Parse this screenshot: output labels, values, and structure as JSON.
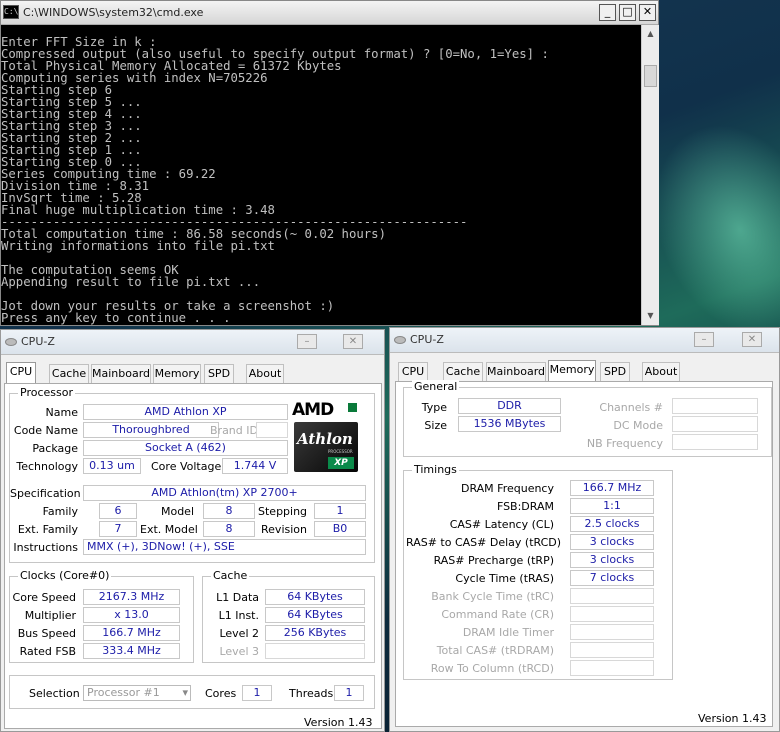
{
  "cmd": {
    "title": "C:\\WINDOWS\\system32\\cmd.exe",
    "icon": "cmd-icon",
    "lines": [
      "Enter FFT Size in k :",
      "Compressed output (also useful to specify output format) ? [0=No, 1=Yes] :",
      "Total Physical Memory Allocated = 61372 Kbytes",
      "Computing series with index N=705226",
      "Starting step 6",
      "Starting step 5 ...",
      "Starting step 4 ...",
      "Starting step 3 ...",
      "Starting step 2 ...",
      "Starting step 1 ...",
      "Starting step 0 ...",
      "Series computing time : 69.22",
      "Division time : 8.31",
      "InvSqrt time : 5.28",
      "Final huge multiplication time : 3.48",
      "---------------------------------------------------------------",
      "Total computation time : 86.58 seconds(~ 0.02 hours)",
      "Writing informations into file pi.txt",
      "",
      "The computation seems OK",
      "Appending result to file pi.txt ...",
      "",
      "Jot down your results or take a screenshot :)",
      "Press any key to continue . . ."
    ],
    "min": "_",
    "max": "□",
    "close": "✕"
  },
  "cpuz_left": {
    "title": "CPU-Z",
    "tabs": [
      "CPU",
      "Cache",
      "Mainboard",
      "Memory",
      "SPD",
      "About"
    ],
    "active_tab": "CPU",
    "processor": {
      "group": "Processor",
      "name_label": "Name",
      "name": "AMD Athlon XP",
      "codename_label": "Code Name",
      "codename": "Thoroughbred",
      "brandid_label": "Brand ID",
      "package_label": "Package",
      "package": "Socket A (462)",
      "technology_label": "Technology",
      "technology": "0.13 um",
      "corevoltage_label": "Core Voltage",
      "corevoltage": "1.744 V",
      "spec_label": "Specification",
      "spec": "AMD Athlon(tm) XP 2700+",
      "family_label": "Family",
      "family": "6",
      "model_label": "Model",
      "model": "8",
      "stepping_label": "Stepping",
      "stepping": "1",
      "extfamily_label": "Ext. Family",
      "extfamily": "7",
      "extmodel_label": "Ext. Model",
      "extmodel": "8",
      "revision_label": "Revision",
      "revision": "B0",
      "instr_label": "Instructions",
      "instr": "MMX (+), 3DNow! (+), SSE"
    },
    "logo": {
      "brand": "AMD",
      "product": "Athlon",
      "sub": "PROCESSOR",
      "suffix": "XP"
    },
    "clocks": {
      "group": "Clocks (Core#0)",
      "corespeed_label": "Core Speed",
      "corespeed": "2167.3 MHz",
      "multiplier_label": "Multiplier",
      "multiplier": "x 13.0",
      "busspeed_label": "Bus Speed",
      "busspeed": "166.7 MHz",
      "ratedfsb_label": "Rated FSB",
      "ratedfsb": "333.4 MHz"
    },
    "cache": {
      "group": "Cache",
      "l1d_label": "L1 Data",
      "l1d": "64 KBytes",
      "l1i_label": "L1 Inst.",
      "l1i": "64 KBytes",
      "l2_label": "Level 2",
      "l2": "256 KBytes",
      "l3_label": "Level 3"
    },
    "selection_label": "Selection",
    "selection": "Processor #1",
    "cores_label": "Cores",
    "cores": "1",
    "threads_label": "Threads",
    "threads": "1",
    "version": "Version 1.43"
  },
  "cpuz_right": {
    "title": "CPU-Z",
    "tabs": [
      "CPU",
      "Cache",
      "Mainboard",
      "Memory",
      "SPD",
      "About"
    ],
    "active_tab": "Memory",
    "general": {
      "group": "General",
      "type_label": "Type",
      "type": "DDR",
      "size_label": "Size",
      "size": "1536 MBytes",
      "channels_label": "Channels #",
      "dcmode_label": "DC Mode",
      "nbfreq_label": "NB Frequency"
    },
    "timings": {
      "group": "Timings",
      "dram_label": "DRAM Frequency",
      "dram": "166.7 MHz",
      "fsbdram_label": "FSB:DRAM",
      "fsbdram": "1:1",
      "cas_label": "CAS# Latency (CL)",
      "cas": "2.5 clocks",
      "trcd_label": "RAS# to CAS# Delay (tRCD)",
      "trcd": "3 clocks",
      "trp_label": "RAS# Precharge (tRP)",
      "trp": "3 clocks",
      "tras_label": "Cycle Time (tRAS)",
      "tras": "7 clocks",
      "trc_label": "Bank Cycle Time (tRC)",
      "cr_label": "Command Rate (CR)",
      "idle_label": "DRAM Idle Timer",
      "trdram_label": "Total CAS# (tRDRAM)",
      "rtc_label": "Row To Column (tRCD)"
    },
    "version": "Version 1.43"
  }
}
